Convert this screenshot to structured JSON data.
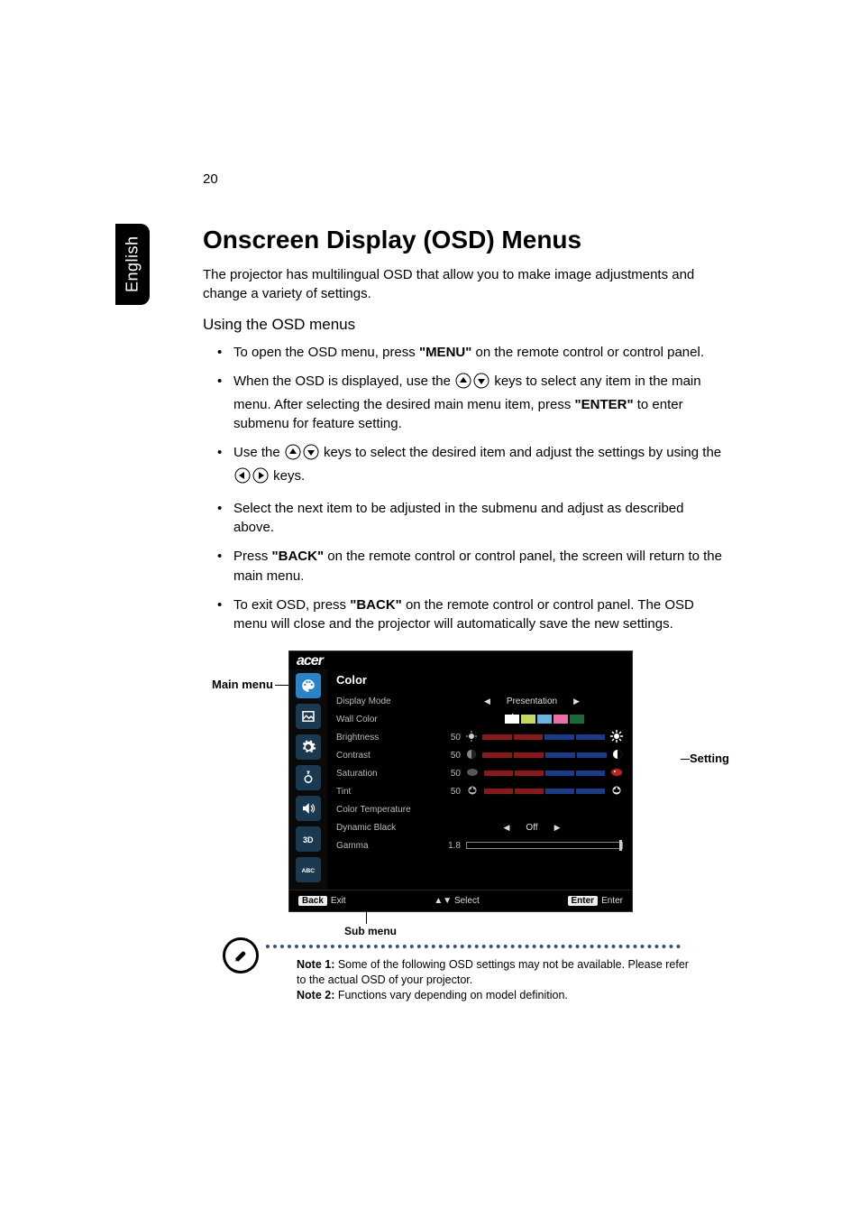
{
  "page_number": "20",
  "language_tab": "English",
  "heading": "Onscreen Display (OSD) Menus",
  "intro": "The projector has multilingual OSD that allow you to make image adjustments and change a variety of settings.",
  "subheading": "Using the OSD menus",
  "bullets": {
    "b1_a": "To open the OSD menu, press ",
    "b1_key": "\"MENU\"",
    "b1_b": " on the remote control or control panel.",
    "b2_a": "When the OSD is displayed, use the ",
    "b2_b": " keys to select any item in the main menu. After selecting the desired main menu item, press ",
    "b2_key": "\"ENTER\"",
    "b2_c": " to enter submenu for feature setting.",
    "b3_a": "Use the ",
    "b3_b": " keys to select the desired item and adjust the settings by using the ",
    "b3_c": " keys.",
    "b4": "Select the next item to be adjusted in the submenu and adjust as described above.",
    "b5_a": "Press ",
    "b5_key": "\"BACK\"",
    "b5_b": " on the remote control or control panel, the screen will return to the main menu.",
    "b6_a": "To exit OSD, press ",
    "b6_key": "\"BACK\"",
    "b6_b": " on the remote control or control panel. The OSD menu will close and the projector will automatically save the new settings."
  },
  "osd_labels": {
    "main_menu": "Main menu",
    "sub_menu": "Sub menu",
    "setting": "Setting"
  },
  "osd": {
    "brand": "acer",
    "title": "Color",
    "side_icons": [
      "palette-icon",
      "image-icon",
      "gear-icon",
      "management-icon",
      "audio-icon",
      "3d-icon",
      "abc-icon"
    ],
    "rows": {
      "display_mode": {
        "label": "Display Mode",
        "value": "Presentation"
      },
      "wall_color": {
        "label": "Wall Color"
      },
      "brightness": {
        "label": "Brightness",
        "value": "50"
      },
      "contrast": {
        "label": "Contrast",
        "value": "50"
      },
      "saturation": {
        "label": "Saturation",
        "value": "50"
      },
      "tint": {
        "label": "Tint",
        "value": "50"
      },
      "color_temp": {
        "label": "Color Temperature"
      },
      "dynamic_black": {
        "label": "Dynamic Black",
        "value": "Off"
      },
      "gamma": {
        "label": "Gamma",
        "value": "1.8"
      }
    },
    "footer": {
      "back_key": "Back",
      "back_label": "Exit",
      "select_label": "Select",
      "enter_key": "Enter",
      "enter_label": "Enter"
    }
  },
  "notes": {
    "n1_label": "Note 1:",
    "n1_text": " Some of the following OSD settings may not be available. Please refer to the actual OSD of your projector.",
    "n2_label": "Note 2:",
    "n2_text": " Functions vary depending on model definition."
  }
}
